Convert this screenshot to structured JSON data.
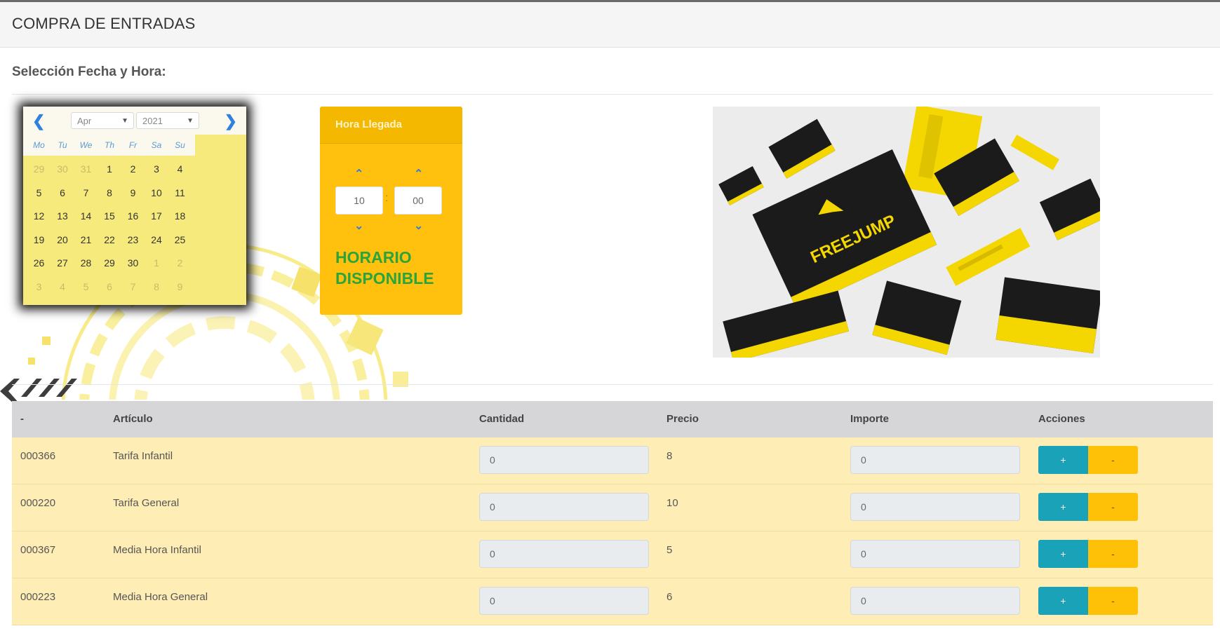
{
  "header": {
    "title": "COMPRA DE ENTRADAS"
  },
  "section": {
    "label": "Selección Fecha y Hora:"
  },
  "calendar": {
    "month": "Apr",
    "year": "2021",
    "weekdays": [
      "Mo",
      "Tu",
      "We",
      "Th",
      "Fr",
      "Sa",
      "Su"
    ],
    "weeks": [
      [
        "29",
        "30",
        "31",
        "1",
        "2",
        "3",
        "4"
      ],
      [
        "5",
        "6",
        "7",
        "8",
        "9",
        "10",
        "11"
      ],
      [
        "12",
        "13",
        "14",
        "15",
        "16",
        "17",
        "18"
      ],
      [
        "19",
        "20",
        "21",
        "22",
        "23",
        "24",
        "25"
      ],
      [
        "26",
        "27",
        "28",
        "29",
        "30",
        "1",
        "2"
      ],
      [
        "3",
        "4",
        "5",
        "6",
        "7",
        "8",
        "9"
      ]
    ],
    "colors": {
      "background": "#f6ea7c",
      "arrow": "#2f80e0"
    }
  },
  "time": {
    "title": "Hora Llegada",
    "hour": "10",
    "minute": "00",
    "separator": ":",
    "status_line1": "HORARIO",
    "status_line2": "DISPONIBLE",
    "colors": {
      "panel": "#ffc10e",
      "status": "#2aa43b"
    }
  },
  "promo": {
    "brand_text": "FREEJUMP"
  },
  "table": {
    "headers": {
      "code": "-",
      "article": "Artículo",
      "qty": "Cantidad",
      "price": "Precio",
      "amount": "Importe",
      "actions": "Acciones"
    },
    "plus_label": "+",
    "minus_label": "-",
    "rows": [
      {
        "code": "000366",
        "article": "Tarifa Infantil",
        "qty": "0",
        "price": "8",
        "amount": "0"
      },
      {
        "code": "000220",
        "article": "Tarifa General",
        "qty": "0",
        "price": "10",
        "amount": "0"
      },
      {
        "code": "000367",
        "article": "Media Hora Infantil",
        "qty": "0",
        "price": "5",
        "amount": "0"
      },
      {
        "code": "000223",
        "article": "Media Hora General",
        "qty": "0",
        "price": "6",
        "amount": "0"
      }
    ],
    "colors": {
      "header": "#d6d6d8",
      "row": "#ffedb6",
      "plus": "#1aa2b8",
      "minus": "#ffc107"
    }
  }
}
